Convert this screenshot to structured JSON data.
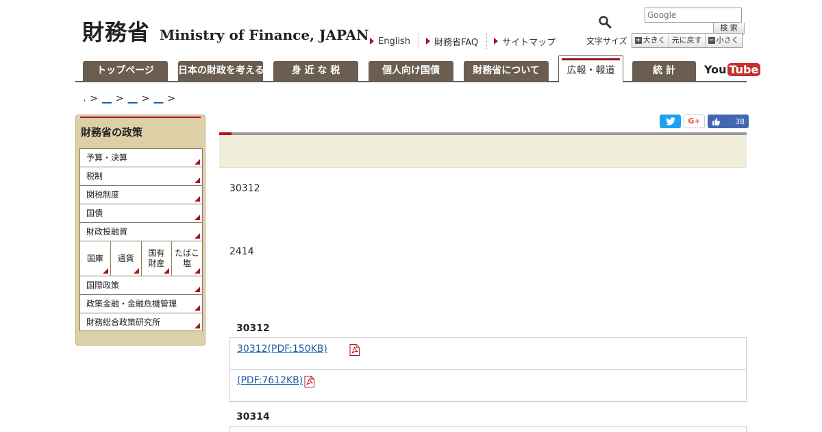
{
  "header": {
    "logo_jp": "財務省",
    "logo_en": "Ministry of Finance, JAPAN",
    "util_links": [
      "English",
      "財務省FAQ",
      "サイトマップ"
    ],
    "search_placeholder": "Google",
    "search_button": "検 索",
    "font_size": {
      "label": "文字サイズ",
      "larger": "大きく",
      "reset": "元に戻す",
      "smaller": "小さく"
    }
  },
  "gnav": {
    "tabs": [
      "トップページ",
      "日本の財政を考える",
      "身 近 な 税",
      "個人向け国債",
      "財務省について",
      "広報・報道",
      "統 計"
    ],
    "active_tab": "広報・報道",
    "youtube_you": "You",
    "youtube_tube": "Tube"
  },
  "breadcrumb": {
    "items": [
      ",",
      ">",
      "__",
      ">",
      "__",
      ">",
      "__",
      ">"
    ]
  },
  "sidebar": {
    "title": "財務省の政策",
    "items_top": [
      "予算・決算",
      "税制",
      "関税制度",
      "国債",
      "財政投融資"
    ],
    "grid": [
      "国庫",
      "通貨",
      "国有\n財産",
      "たばこ\n塩"
    ],
    "items_bottom": [
      "国際政策",
      "政策金融・金融危機管理",
      "財務総合政策研究所"
    ]
  },
  "share": {
    "gplus": "G+",
    "like_count": "38"
  },
  "main": {
    "para1": "30312",
    "para2": "2414",
    "section1": {
      "heading": "30312",
      "files": [
        "30312(PDF:150KB)",
        "(PDF:7612KB)"
      ]
    },
    "section2": {
      "heading": "30314"
    }
  },
  "colors": {
    "accent_red": "#b01020",
    "nav_brown": "#6b5e50",
    "sidebar_bg": "#ddd0a6",
    "link_blue": "#1a5aa8"
  }
}
